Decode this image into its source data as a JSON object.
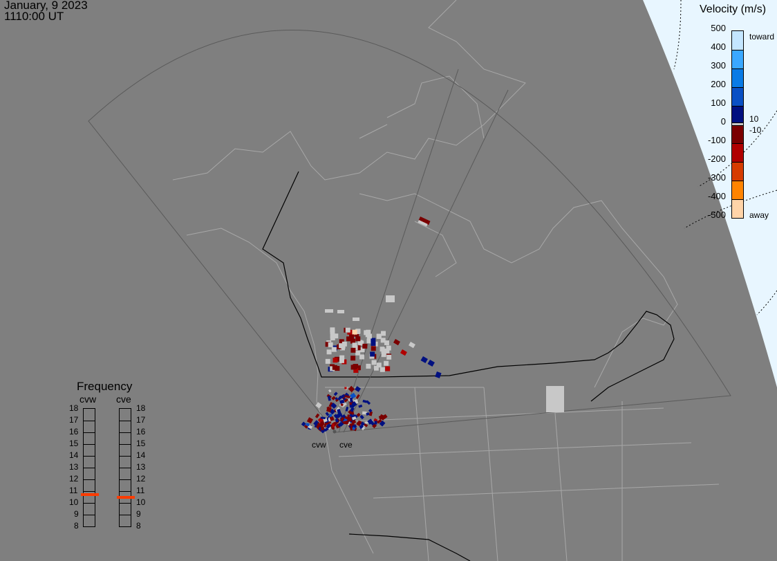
{
  "header": {
    "date": "January, 9 2023",
    "time": "1110:00 UT"
  },
  "velocity_legend": {
    "title": "Velocity (m/s)",
    "ticks": [
      "500",
      "400",
      "300",
      "200",
      "100",
      "0",
      "-100",
      "-200",
      "-300",
      "-400",
      "-500"
    ],
    "toward_label": "toward",
    "away_label": "away",
    "gs_upper": "10",
    "gs_lower": "-10",
    "colors": [
      "#c4e6ff",
      "#3aa8ff",
      "#0a7be6",
      "#0a50c4",
      "#001080",
      "#7a0000",
      "#b00000",
      "#d63c00",
      "#ff8400",
      "#ffd4a8"
    ],
    "ground_scatter_color": "#c8c8c8"
  },
  "frequency_panel": {
    "title": "Frequency",
    "radars": [
      {
        "name": "cvw",
        "frequency_mhz": 10.7
      },
      {
        "name": "cve",
        "frequency_mhz": 10.5
      }
    ],
    "ticks": [
      "18",
      "17",
      "16",
      "15",
      "14",
      "13",
      "12",
      "11",
      "10",
      "9",
      "8"
    ],
    "range": [
      8,
      18
    ],
    "marker_color": "#ff3c00"
  },
  "radar_sites": [
    {
      "name": "cvw"
    },
    {
      "name": "cve"
    }
  ],
  "colors": {
    "background": "#7f7f7f",
    "dayside": "#e8f6ff",
    "coastline": "#a8a8a8"
  }
}
